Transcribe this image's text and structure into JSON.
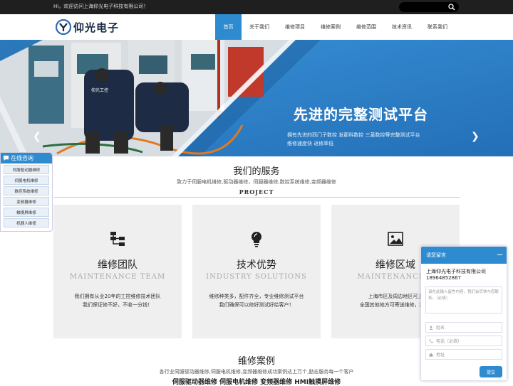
{
  "topbar": {
    "welcome": "Hi，欢迎访问上海仰光电子科技有限公司！"
  },
  "header": {
    "logo_text": "仰光电子",
    "nav": [
      {
        "label": "首页",
        "active": true
      },
      {
        "label": "关于我们",
        "active": false
      },
      {
        "label": "维修项目",
        "active": false
      },
      {
        "label": "维修案例",
        "active": false
      },
      {
        "label": "维修范围",
        "active": false
      },
      {
        "label": "技术资讯",
        "active": false
      },
      {
        "label": "联系我们",
        "active": false
      }
    ]
  },
  "banner": {
    "title": "先进的完整测试平台",
    "sub1": "拥有先进的西门子数控 发那科数控 三菱数控等完整测试平台",
    "sub2": "维修速度快 返修率低",
    "photo_caption": "仰光工控",
    "slides": 3,
    "active_slide": 1
  },
  "services": {
    "title": "我们的服务",
    "subtitle": "致力于伺服电机维修,驱动器维修，伺服器维修,数控系统维修,变频器维修",
    "label": "PROJECT",
    "cards": [
      {
        "icon": "sitemap-icon",
        "title": "维修团队",
        "en": "MAINTENANCE TEAM",
        "desc1": "我们拥有从业20年的工控维修技术团队",
        "desc2": "我们保证修不好，不收一分钱！"
      },
      {
        "icon": "lightbulb-icon",
        "title": "技术优势",
        "en": "INDUSTRY SOLUTIONS",
        "desc1": "维修种类多，配件齐全，专业维修测试平台",
        "desc2": "我们确保可以修好测试好给客户！"
      },
      {
        "icon": "image-icon",
        "title": "维修区域",
        "en": "MAINTENANCE A",
        "desc1": "上海市区及周边地区可上",
        "desc2": "全国其他地方可寄送维修，提供-"
      }
    ]
  },
  "cases": {
    "title": "维修案例",
    "subtitle": "各行业伺服驱动器维修,伺服电机维修,变频器维修成功案例达上万个,励志服务每一个客户",
    "tags": "伺服驱动器维修 伺服电机维修  变频器维修  HMI触摸屏维修"
  },
  "sidebar": {
    "title": "在线咨询",
    "items": [
      "伺服驱动器维修",
      "伺服电机维修",
      "数控系统维修",
      "变频器维修",
      "触摸屏维修",
      "机器人维修"
    ]
  },
  "form": {
    "header": "请您留言",
    "company": "上海仰光电子科技有限公司",
    "phone": "18964852867",
    "message_placeholder": "请在此输入留言内容，我们会尽快与您联系。（必填）",
    "name_placeholder": "姓名",
    "tel_placeholder": "电话（必填）",
    "addr_placeholder": "地址",
    "submit": "提交"
  },
  "colors": {
    "accent": "#2f8bd0",
    "topbar": "#1f1f1f",
    "card_bg": "#efefef"
  }
}
